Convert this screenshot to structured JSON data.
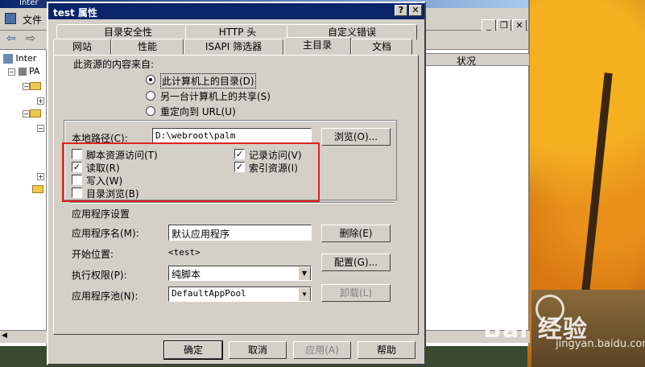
{
  "iis": {
    "title_fragment": "Inter",
    "menu_file": "文件",
    "tree": [
      "Inter",
      "PA"
    ],
    "column_status": "状况"
  },
  "dialog": {
    "title": "test 属性",
    "help_btn": "?",
    "close_btn": "✕",
    "tabs_back": [
      "目录安全性",
      "HTTP 头",
      "自定义错误"
    ],
    "tabs_front": [
      "网站",
      "性能",
      "ISAPI 筛选器",
      "主目录",
      "文档"
    ],
    "source_label": "此资源的内容来自:",
    "radios": [
      {
        "label": "此计算机上的目录(D)",
        "checked": true
      },
      {
        "label": "另一台计算机上的共享(S)",
        "checked": false
      },
      {
        "label": "重定向到 URL(U)",
        "checked": false
      }
    ],
    "local_path_label": "本地路径(C):",
    "local_path_value": "D:\\webroot\\palm",
    "browse_button": "浏览(O)...",
    "checkboxes_left": [
      {
        "label": "脚本资源访问(T)",
        "checked": false
      },
      {
        "label": "读取(R)",
        "checked": true
      },
      {
        "label": "写入(W)",
        "checked": false
      },
      {
        "label": "目录浏览(B)",
        "checked": false
      }
    ],
    "checkboxes_right": [
      {
        "label": "记录访问(V)",
        "checked": true
      },
      {
        "label": "索引资源(I)",
        "checked": true
      }
    ],
    "app_settings_title": "应用程序设置",
    "app_name_label": "应用程序名(M):",
    "app_name_value": "默认应用程序",
    "remove_button": "删除(E)",
    "start_label": "开始位置:",
    "start_value": "<test>",
    "config_button": "配置(G)...",
    "exec_label": "执行权限(P):",
    "exec_value": "纯脚本",
    "pool_label": "应用程序池(N):",
    "pool_value": "DefaultAppPool",
    "unload_button": "卸载(L)",
    "ok": "确定",
    "cancel": "取消",
    "apply": "应用(A)",
    "help": "帮助",
    "checkmark": "✓"
  },
  "watermark": {
    "brand": "Bai 经验",
    "url": "jingyan.baidu.com"
  },
  "colors": {
    "title_bar": "#0a246a",
    "face": "#d4d0c8",
    "highlight_box": "#e02020"
  }
}
